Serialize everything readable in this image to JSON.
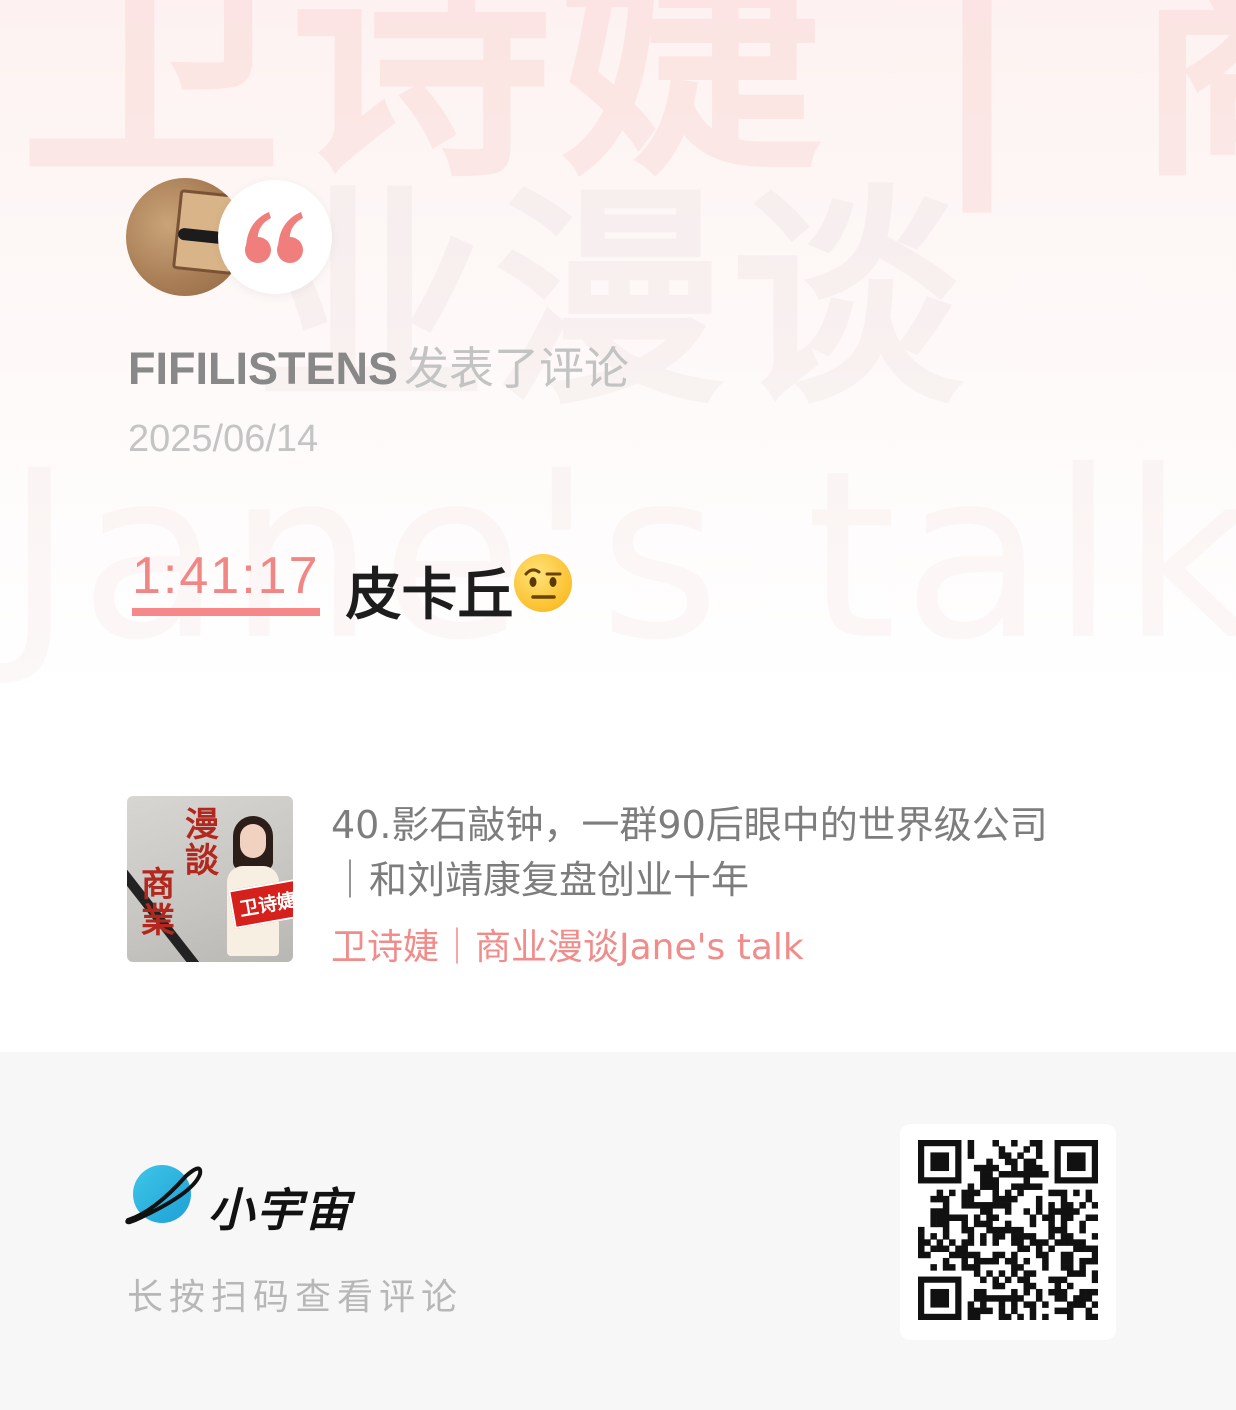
{
  "watermark": {
    "line1": "卫诗婕 | 商",
    "line2": "业漫谈",
    "line3": "Jane's talk"
  },
  "author": {
    "name": "FIFILISTENS",
    "action": "发表了评论",
    "date": "2025/06/14"
  },
  "comment": {
    "timestamp": "1:41:17",
    "text": "皮卡丘",
    "emoji": "face-with-raised-eyebrow"
  },
  "episode": {
    "title": "40.影石敲钟，一群90后眼中的世界级公司｜和刘靖康复盘创业十年",
    "podcast": "卫诗婕｜商业漫谈Jane's talk",
    "cover_text": [
      "漫",
      "談",
      "商",
      "業"
    ],
    "cover_tag": "卫诗婕"
  },
  "footer": {
    "app_name": "小宇宙",
    "scan_hint": "长按扫码查看评论"
  },
  "colors": {
    "accent": "#f08785",
    "podcast_link": "#f08d8b",
    "footer_bg": "#f7f7f7"
  }
}
